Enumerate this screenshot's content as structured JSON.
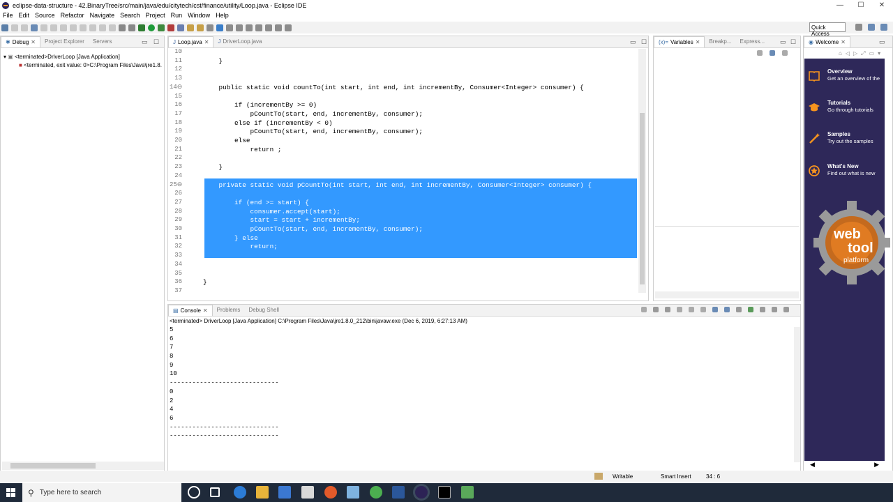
{
  "window": {
    "title": "eclipse-data-structure - 42.BinaryTree/src/main/java/edu/citytech/cst/finance/utility/Loop.java - Eclipse IDE",
    "minimize": "—",
    "maximize": "☐",
    "close": "✕"
  },
  "menu": [
    "File",
    "Edit",
    "Source",
    "Refactor",
    "Navigate",
    "Search",
    "Project",
    "Run",
    "Window",
    "Help"
  ],
  "toolbar": {
    "quick_access": "Quick Access"
  },
  "left_panel": {
    "tabs": [
      {
        "label": "Debug",
        "active": true
      },
      {
        "label": "Project Explorer",
        "active": false
      },
      {
        "label": "Servers",
        "active": false
      }
    ],
    "tree": [
      "<terminated>DriverLoop [Java Application]",
      "<terminated, exit value: 0>C:\\Program Files\\Java\\jre1.8."
    ]
  },
  "editor": {
    "tabs": [
      {
        "label": "Loop.java",
        "active": true
      },
      {
        "label": "DriverLoop.java",
        "active": false
      }
    ],
    "lines": [
      {
        "n": "10",
        "t": ""
      },
      {
        "n": "11",
        "t": "    }"
      },
      {
        "n": "12",
        "t": ""
      },
      {
        "n": "13",
        "t": ""
      },
      {
        "n": "14⊖",
        "t": "    public static void countTo(int start, int end, int incrementBy, Consumer<Integer> consumer) {"
      },
      {
        "n": "15",
        "t": ""
      },
      {
        "n": "16",
        "t": "        if (incrementBy >= 0)"
      },
      {
        "n": "17",
        "t": "            pCountTo(start, end, incrementBy, consumer);"
      },
      {
        "n": "18",
        "t": "        else if (incrementBy < 0)"
      },
      {
        "n": "19",
        "t": "            pCountTo(start, end, incrementBy, consumer);"
      },
      {
        "n": "20",
        "t": "        else"
      },
      {
        "n": "21",
        "t": "            return ;"
      },
      {
        "n": "22",
        "t": ""
      },
      {
        "n": "23",
        "t": "    }"
      },
      {
        "n": "24",
        "t": ""
      },
      {
        "n": "25⊖",
        "t": "    private static void pCountTo(int start, int end, int incrementBy, Consumer<Integer> consumer) {"
      },
      {
        "n": "26",
        "t": ""
      },
      {
        "n": "27",
        "t": "        if (end >= start) {"
      },
      {
        "n": "28",
        "t": "            consumer.accept(start);"
      },
      {
        "n": "29",
        "t": "            start = start + incrementBy;"
      },
      {
        "n": "30",
        "t": "            pCountTo(start, end, incrementBy, consumer);"
      },
      {
        "n": "31",
        "t": "        } else"
      },
      {
        "n": "32",
        "t": "            return;"
      },
      {
        "n": "33",
        "t": ""
      },
      {
        "n": "34",
        "t": "    }"
      },
      {
        "n": "35",
        "t": ""
      },
      {
        "n": "36",
        "t": "}"
      },
      {
        "n": "37",
        "t": ""
      }
    ]
  },
  "variables_panel": {
    "tabs": [
      {
        "label": "Variables",
        "active": true
      },
      {
        "label": "Breakp...",
        "active": false
      },
      {
        "label": "Express...",
        "active": false
      }
    ]
  },
  "welcome_panel": {
    "tab": "Welcome",
    "items": [
      {
        "title": "Overview",
        "desc": "Get an overview of the"
      },
      {
        "title": "Tutorials",
        "desc": "Go through tutorials"
      },
      {
        "title": "Samples",
        "desc": "Try out the samples"
      },
      {
        "title": "What's New",
        "desc": "Find out what is new"
      }
    ],
    "logo_text": [
      "web",
      "tool",
      "platform"
    ]
  },
  "console": {
    "tabs": [
      {
        "label": "Console",
        "active": true
      },
      {
        "label": "Problems",
        "active": false
      },
      {
        "label": "Debug Shell",
        "active": false
      }
    ],
    "header": "<terminated> DriverLoop [Java Application] C:\\Program Files\\Java\\jre1.8.0_212\\bin\\javaw.exe (Dec 6, 2019, 6:27:13 AM)",
    "lines": [
      "5",
      "6",
      "7",
      "8",
      "9",
      "10",
      "-----------------------------",
      "0",
      "2",
      "4",
      "6",
      "-----------------------------",
      "-----------------------------"
    ]
  },
  "status": {
    "writable": "Writable",
    "insert_mode": "Smart Insert",
    "position": "34 : 6"
  },
  "taskbar": {
    "search_placeholder": "Type here to search"
  },
  "colors": {
    "selection": "#3399ff",
    "keyword": "#7f0055",
    "welcome_bg": "#2e2859",
    "taskbar": "#1f2a3a"
  }
}
